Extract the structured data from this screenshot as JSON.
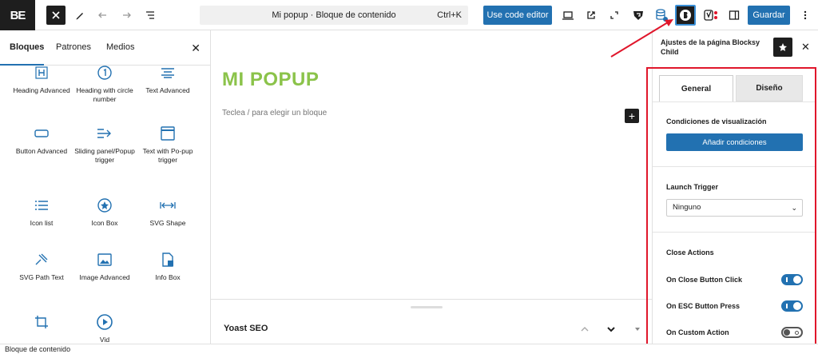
{
  "topbar": {
    "logo_text": "BE",
    "document_title": "Mi popup · Bloque de contenido",
    "shortcut": "Ctrl+K",
    "code_editor_label": "Use code editor",
    "save_label": "Guardar"
  },
  "left_panel": {
    "tabs": [
      "Bloques",
      "Patrones",
      "Medios"
    ],
    "blocks": [
      {
        "label": "Heading Advanced",
        "icon": "heading-h-icon"
      },
      {
        "label": "Heading with circle number",
        "icon": "circle-number-icon"
      },
      {
        "label": "Text Advanced",
        "icon": "text-align-icon"
      },
      {
        "label": "Button Advanced",
        "icon": "button-icon"
      },
      {
        "label": "Sliding panel/Popup trigger",
        "icon": "arrow-right-lines-icon"
      },
      {
        "label": "Text with Po-pup trigger",
        "icon": "window-icon"
      },
      {
        "label": "Icon list",
        "icon": "list-icon"
      },
      {
        "label": "Icon Box",
        "icon": "star-circle-icon"
      },
      {
        "label": "SVG Shape",
        "icon": "width-arrows-icon"
      },
      {
        "label": "SVG Path Text",
        "icon": "path-text-icon"
      },
      {
        "label": "Image Advanced",
        "icon": "image-icon"
      },
      {
        "label": "Info Box",
        "icon": "info-doc-icon"
      },
      {
        "label": "",
        "icon": "crop-icon"
      },
      {
        "label": "Vid",
        "icon": "play-circle-icon"
      }
    ]
  },
  "canvas": {
    "title": "MI POPUP",
    "placeholder": "Teclea / para elegir un bloque",
    "title_color": "#8bc34a",
    "yoast_label": "Yoast SEO"
  },
  "right_panel": {
    "heading": "Ajustes de la página Blocksy Child",
    "tabs": {
      "general": "General",
      "design": "Diseño"
    },
    "visibility_label": "Condiciones de visualización",
    "add_conditions": "Añadir condiciones",
    "launch_trigger_label": "Launch Trigger",
    "launch_trigger_value": "Ninguno",
    "close_actions_label": "Close Actions",
    "toggles": [
      {
        "label": "On Close Button Click",
        "on": true
      },
      {
        "label": "On ESC Button Press",
        "on": true
      },
      {
        "label": "On Custom Action",
        "on": false
      }
    ]
  },
  "status_bar": {
    "text": "Bloque de contenido"
  },
  "colors": {
    "accent": "#2271b1",
    "highlight": "#e0162b",
    "title": "#8bc34a"
  }
}
